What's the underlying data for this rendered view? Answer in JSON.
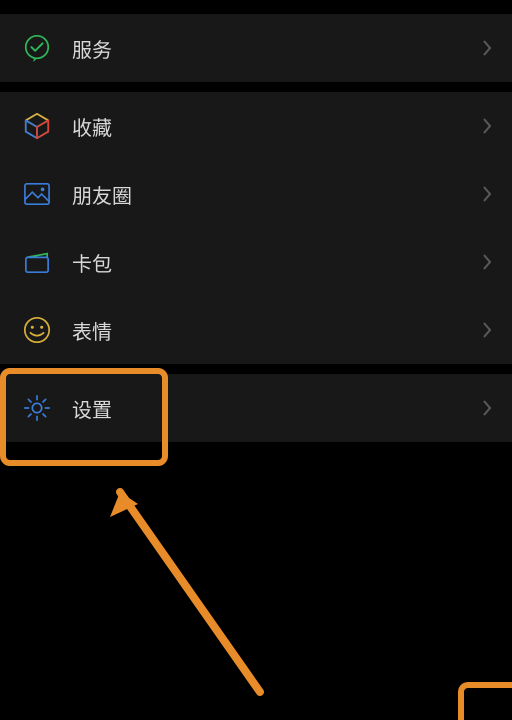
{
  "menu": {
    "services": {
      "label": "服务"
    },
    "favorites": {
      "label": "收藏"
    },
    "moments": {
      "label": "朋友圈"
    },
    "cards": {
      "label": "卡包"
    },
    "stickers": {
      "label": "表情"
    },
    "settings": {
      "label": "设置"
    }
  }
}
